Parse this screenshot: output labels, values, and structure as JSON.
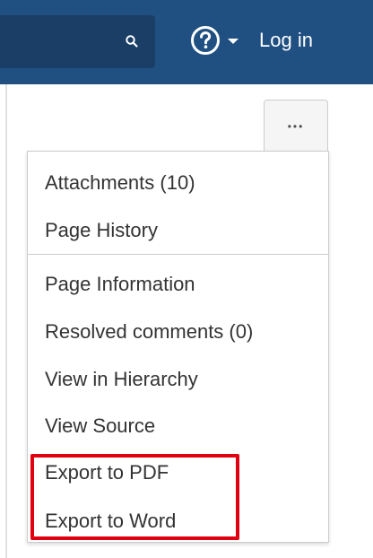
{
  "header": {
    "help_icon": "help-circle-icon",
    "search_icon": "search-icon",
    "login_label": "Log in"
  },
  "toolbar": {
    "more_label": "•••"
  },
  "menu": {
    "items": [
      {
        "label": "Attachments (10)"
      },
      {
        "label": "Page History"
      },
      {
        "label": "Page Information"
      },
      {
        "label": "Resolved comments (0)"
      },
      {
        "label": "View in Hierarchy"
      },
      {
        "label": "View Source"
      },
      {
        "label": "Export to PDF"
      },
      {
        "label": "Export to Word"
      }
    ]
  },
  "colors": {
    "topbar": "#205081",
    "highlight": "#e0000f"
  }
}
